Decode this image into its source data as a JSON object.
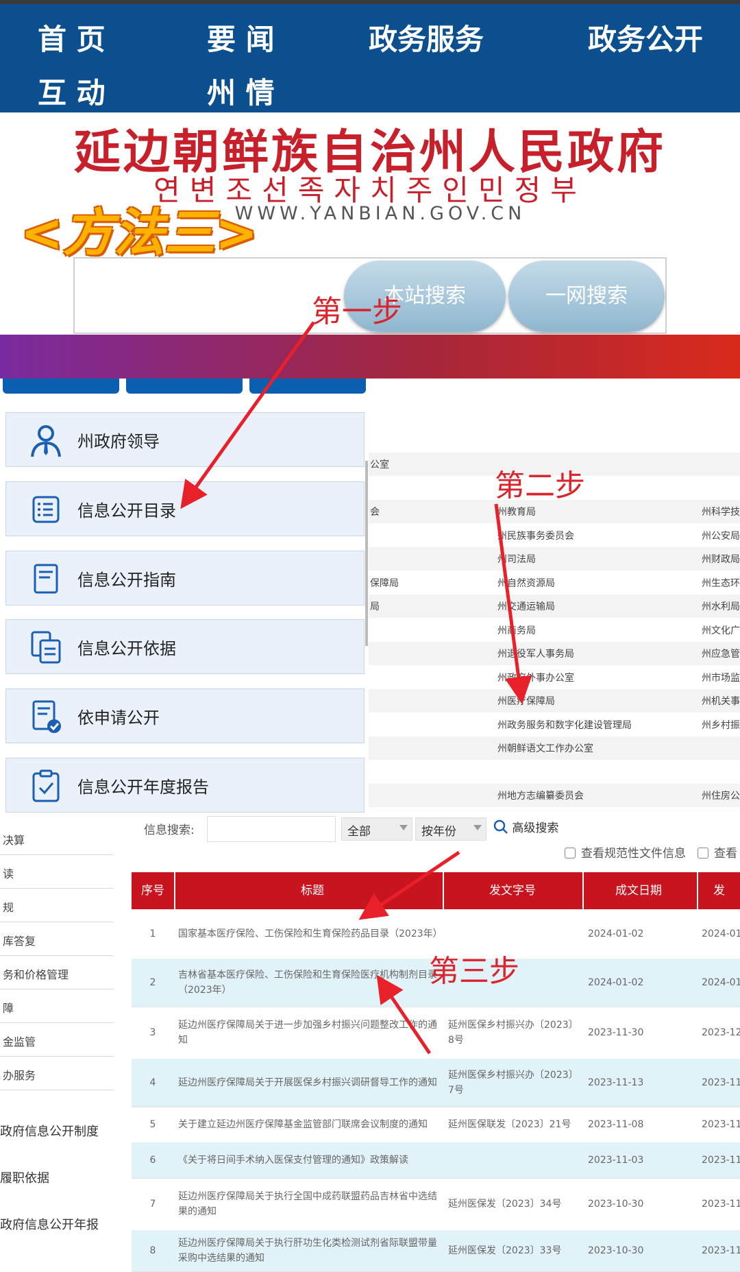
{
  "nav": [
    {
      "label": "首 页"
    },
    {
      "label": "要 闻"
    },
    {
      "label": "政务服务"
    },
    {
      "label": "政务公开"
    },
    {
      "label": "互 动"
    },
    {
      "label": "州 情"
    }
  ],
  "header": {
    "title": "延边朝鲜族自治州人民政府",
    "korean": "연변조선족자치주인민정부",
    "url": "WWW.YANBIAN.GOV.CN",
    "method_label": "<方法三>"
  },
  "search": {
    "site_label": "本站搜索",
    "web_label": "一网搜索"
  },
  "steps": {
    "step1": "第一步",
    "step2": "第二步",
    "step3": "第三步"
  },
  "menu": [
    {
      "label": "州政府领导",
      "icon": "person-icon"
    },
    {
      "label": "信息公开目录",
      "icon": "list-icon"
    },
    {
      "label": "信息公开指南",
      "icon": "document-icon"
    },
    {
      "label": "信息公开依据",
      "icon": "files-icon"
    },
    {
      "label": "依申请公开",
      "icon": "form-check-icon"
    },
    {
      "label": "信息公开年度报告",
      "icon": "clipboard-check-icon"
    }
  ],
  "dept_grid": [
    {
      "c1": "公室",
      "c2": "",
      "c3": ""
    },
    {
      "c1": "",
      "c2": "",
      "c3": ""
    },
    {
      "c1": "会",
      "c2": "州教育局",
      "c3": "州科学技"
    },
    {
      "c1": "",
      "c2": "州民族事务委员会",
      "c3": "州公安局"
    },
    {
      "c1": "",
      "c2": "州司法局",
      "c3": "州财政局"
    },
    {
      "c1": "保障局",
      "c2": "州自然资源局",
      "c3": "州生态环"
    },
    {
      "c1": "局",
      "c2": "州交通运输局",
      "c3": "州水利局"
    },
    {
      "c1": "",
      "c2": "州商务局",
      "c3": "州文化广"
    },
    {
      "c1": "",
      "c2": "州退役军人事务局",
      "c3": "州应急管"
    },
    {
      "c1": "",
      "c2": "州政府外事办公室",
      "c3": "州市场监"
    },
    {
      "c1": "",
      "c2": "州医疗保障局",
      "c3": "州机关事"
    },
    {
      "c1": "",
      "c2": "州政务服务和数字化建设管理局",
      "c3": "州乡村振"
    },
    {
      "c1": "",
      "c2": "州朝鲜语文工作办公室",
      "c3": ""
    },
    {
      "c1": "",
      "c2": "",
      "c3": ""
    },
    {
      "c1": "",
      "c2": "州地方志编纂委员会",
      "c3": "州住房公"
    }
  ],
  "side_links": [
    "决算",
    "读",
    "规",
    "库答复",
    "务和价格管理",
    "障",
    "金监管",
    "办服务"
  ],
  "side_big": [
    "政府信息公开制度",
    "履职依据",
    "政府信息公开年报"
  ],
  "filter": {
    "label": "信息搜索:",
    "scope": "全部",
    "year": "按年份",
    "advanced": "高级搜索",
    "check1": "查看规范性文件信息",
    "check2": "查看"
  },
  "table": {
    "headers": [
      "序号",
      "标题",
      "发文字号",
      "成文日期",
      "发"
    ],
    "rows": [
      {
        "no": "1",
        "title": "国家基本医疗保险、工伤保险和生育保险药品目录（2023年）",
        "doc": "",
        "date": "2024-01-02",
        "pub": "2024-01"
      },
      {
        "no": "2",
        "title": "吉林省基本医疗保险、工伤保险和生育保险医疗机构制剂目录（2023年）",
        "doc": "",
        "date": "2024-01-02",
        "pub": "2024-01"
      },
      {
        "no": "3",
        "title": "延边州医疗保障局关于进一步加强乡村振兴问题整改工作的通知",
        "doc": "延州医保乡村振兴办〔2023〕8号",
        "date": "2023-11-30",
        "pub": "2023-12"
      },
      {
        "no": "4",
        "title": "延边州医疗保障局关于开展医保乡村振兴调研督导工作的通知",
        "doc": "延州医保乡村振兴办〔2023〕7号",
        "date": "2023-11-13",
        "pub": "2023-11"
      },
      {
        "no": "5",
        "title": "关于建立延边州医疗保障基金监管部门联席会议制度的通知",
        "doc": "延州医保联发〔2023〕21号",
        "date": "2023-11-08",
        "pub": "2023-11"
      },
      {
        "no": "6",
        "title": "《关于将日间手术纳入医保支付管理的通知》政策解读",
        "doc": "",
        "date": "2023-11-03",
        "pub": "2023-11"
      },
      {
        "no": "7",
        "title": "延边州医疗保障局关于执行全国中成药联盟药品吉林省中选结果的通知",
        "doc": "延州医保发〔2023〕34号",
        "date": "2023-10-30",
        "pub": "2023-11"
      },
      {
        "no": "8",
        "title": "延边州医疗保障局关于执行肝功生化类检测试剂省际联盟带量采购中选结果的通知",
        "doc": "延州医保发〔2023〕33号",
        "date": "2023-10-30",
        "pub": "2023-11"
      }
    ]
  },
  "colors": {
    "nav_bg": "#0b4f8f",
    "title_red": "#c8202a",
    "step_red": "#d9262e",
    "table_head": "#c8141e",
    "row_alt": "#e1f2f8"
  }
}
